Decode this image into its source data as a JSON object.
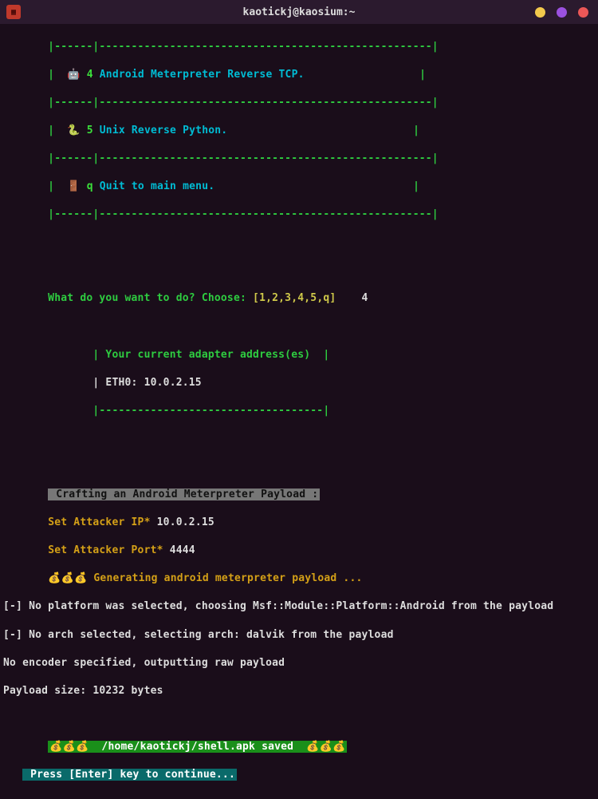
{
  "window": {
    "title": "kaotickj@kaosium:~"
  },
  "menu": {
    "border_top": "       |------|----------------------------------------------------|",
    "opt4_icon": "🤖",
    "opt4_num": "4",
    "opt4_txt": "Android Meterpreter Reverse TCP.",
    "opt5_icon": "🐍",
    "opt5_num": "5",
    "opt5_txt": "Unix Reverse Python.",
    "optq_icon": "🚪",
    "optq_num": "q",
    "optq_txt": "Quit to main menu.",
    "border_bot": "       |------|----------------------------------------------------|"
  },
  "prompt": {
    "question": "       What do you want to do? Choose: ",
    "options": "[1,2,3,4,5,q]",
    "input": "4"
  },
  "adapter": {
    "header": "| Your current adapter address(es)  |",
    "eth": "| ETH0: 10.0.2.15",
    "footer": "|-----------------------------------|"
  },
  "craft": {
    "title": " Crafting an Android Meterpreter Payload :",
    "ip_label": "Set Attacker IP*",
    "ip_val": "10.0.2.15",
    "port_label": "Set Attacker Port*",
    "port_val": "4444",
    "gen": " Generating android meterpreter payload ..."
  },
  "msf": {
    "line1": "[-] No platform was selected, choosing Msf::Module::Platform::Android from the payload",
    "line2": "[-] No arch selected, selecting arch: dalvik from the payload",
    "line3": "No encoder specified, outputting raw payload",
    "line4": "Payload size: 10232 bytes"
  },
  "saved": {
    "path": "  /home/kaotickj/shell.apk saved  "
  },
  "continue": {
    "text": " Press [Enter] key to continue..."
  }
}
